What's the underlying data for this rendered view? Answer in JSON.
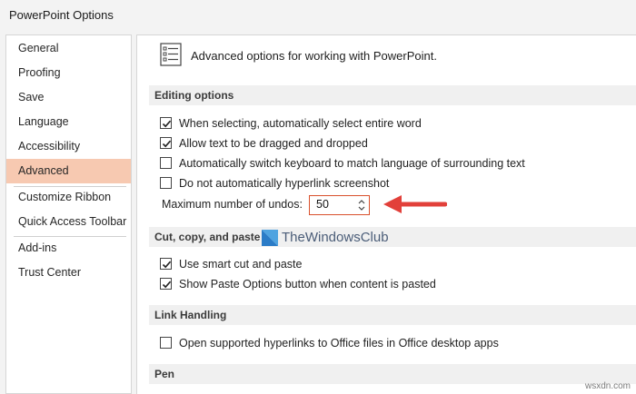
{
  "window": {
    "title": "PowerPoint Options"
  },
  "sidebar": {
    "items": [
      {
        "label": "General",
        "selected": false
      },
      {
        "label": "Proofing",
        "selected": false
      },
      {
        "label": "Save",
        "selected": false
      },
      {
        "label": "Language",
        "selected": false
      },
      {
        "label": "Accessibility",
        "selected": false
      },
      {
        "label": "Advanced",
        "selected": true
      },
      {
        "label": "Customize Ribbon",
        "selected": false
      },
      {
        "label": "Quick Access Toolbar",
        "selected": false
      },
      {
        "label": "Add-ins",
        "selected": false
      },
      {
        "label": "Trust Center",
        "selected": false
      }
    ]
  },
  "header": {
    "icon": "options-list-icon",
    "text": "Advanced options for working with PowerPoint."
  },
  "sections": {
    "editing": {
      "title": "Editing options",
      "options": [
        {
          "label": "When selecting, automatically select entire word",
          "checked": true
        },
        {
          "label": "Allow text to be dragged and dropped",
          "checked": true
        },
        {
          "label": "Automatically switch keyboard to match language of surrounding text",
          "checked": false
        },
        {
          "label": "Do not automatically hyperlink screenshot",
          "checked": false
        }
      ],
      "max_undos": {
        "label": "Maximum number of undos:",
        "value": "50"
      }
    },
    "cut_copy_paste": {
      "title": "Cut, copy, and paste",
      "options": [
        {
          "label": "Use smart cut and paste",
          "checked": true
        },
        {
          "label": "Show Paste Options button when content is pasted",
          "checked": true
        }
      ]
    },
    "link_handling": {
      "title": "Link Handling",
      "options": [
        {
          "label": "Open supported hyperlinks to Office files in Office desktop apps",
          "checked": false
        }
      ]
    },
    "pen": {
      "title": "Pen"
    }
  },
  "overlay": {
    "watermark": "TheWindowsClub",
    "site": "wsxdn.com",
    "arrow_color": "#e2403a"
  }
}
